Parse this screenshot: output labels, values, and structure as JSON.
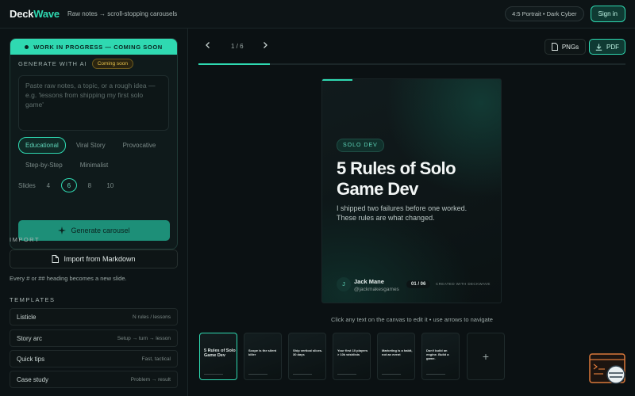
{
  "header": {
    "logo_main": "Deck",
    "logo_accent": "Wave",
    "tagline": "Raw notes → scroll-stopping carousels",
    "preset": "4:5 Portrait • Dark Cyber",
    "signin": "Sign in"
  },
  "ai": {
    "banner": "WORK IN PROGRESS — COMING SOON",
    "label": "GENERATE WITH AI",
    "badge": "Coming soon",
    "placeholder": "Paste raw notes, a topic, or a rough idea — e.g. 'lessons from shipping my first solo game'",
    "styles": [
      "Educational",
      "Viral Story",
      "Provocative",
      "Step-by-Step",
      "Minimalist"
    ],
    "active_style": "Educational",
    "slides_label": "Slides",
    "slide_options": [
      "4",
      "6",
      "8",
      "10"
    ],
    "active_slides": "6",
    "generate": "Generate carousel"
  },
  "import": {
    "title": "IMPORT",
    "button": "Import from Markdown",
    "hint": "Every # or ## heading becomes a new slide."
  },
  "templates": {
    "title": "TEMPLATES",
    "items": [
      {
        "name": "Listicle",
        "meta": "N rules / lessons"
      },
      {
        "name": "Story arc",
        "meta": "Setup → turn → lesson"
      },
      {
        "name": "Quick tips",
        "meta": "Fast, tactical"
      },
      {
        "name": "Case study",
        "meta": "Problem → result"
      }
    ]
  },
  "toolbar": {
    "page": "1 / 6",
    "prev_icon": "chevron-left-icon",
    "next_icon": "chevron-right-icon",
    "png_label": "PNGs",
    "pdf_label": "PDF",
    "progress": 0.1667
  },
  "slide": {
    "tag": "SOLO DEV",
    "title": "5 Rules of Solo Game Dev",
    "subtitle": "I shipped two failures before one worked. These rules are what changed.",
    "avatar": "J",
    "author": "Jack Mane",
    "handle": "@jackmakesgames",
    "number": "01 / 06",
    "created": "CREATED WITH DECKWAVE"
  },
  "hint": "Click any text on the canvas to edit it • use arrows to navigate",
  "thumbnails": [
    {
      "title": "5 Rules of Solo Game Dev"
    },
    {
      "title": "Scope is the silent killer"
    },
    {
      "title": "Ship vertical slices. 30 days"
    },
    {
      "title": "Your first 10 players > 10k wishlists"
    },
    {
      "title": "Marketing is a habit, not an event"
    },
    {
      "title": "Don't build an engine. Build a game."
    }
  ],
  "colors": {
    "accent": "#2fd9b1",
    "background": "#0b1113",
    "badge": "#e9c44c"
  }
}
